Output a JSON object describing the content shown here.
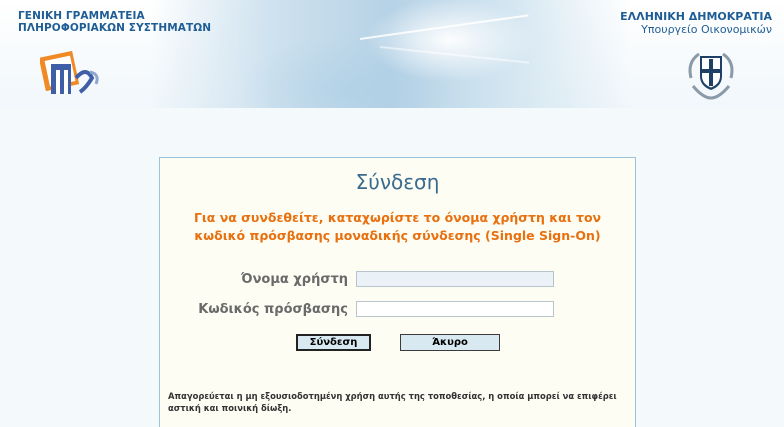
{
  "header": {
    "left_title_line1": "ΓΕΝΙΚΗ ΓΡΑΜΜΑΤΕΙΑ",
    "left_title_line2": "ΠΛΗΡΟΦΟΡΙΑΚΩΝ ΣΥΣΤΗΜΑΤΩΝ",
    "right_title_line1": "ΕΛΛΗΝΙΚΗ ΔΗΜΟΚΡΑΤΙΑ",
    "right_title_line2": "Υπουργείο Οικονομικών",
    "logo_icon": "gsis-logo-icon",
    "emblem_icon": "greek-coat-of-arms-icon",
    "brand_color": "#1f5d95"
  },
  "login": {
    "title": "Σύνδεση",
    "instructions_line1": "Για να συνδεθείτε, καταχωρίστε το όνομα χρήστη και τον",
    "instructions_line2": "κωδικό πρόσβασης μοναδικής σύνδεσης (Single Sign-On)",
    "username_label": "Όνομα χρήστη",
    "username_value": "",
    "password_label": "Κωδικός πρόσβασης",
    "password_value": "",
    "login_button": "Σύνδεση",
    "cancel_button": "Άκυρο",
    "warning_line1": "Απαγορεύεται η μη εξουσιοδοτημένη χρήση αυτής της τοποθεσίας, η οποία μπορεί να επιφέρει",
    "warning_line2": "αστική και ποινική δίωξη.",
    "accent_color": "#e8700f",
    "title_color": "#3a6b8e"
  }
}
